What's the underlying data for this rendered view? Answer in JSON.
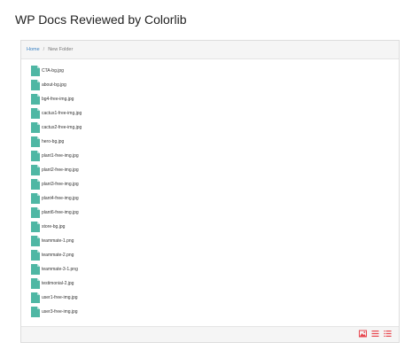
{
  "page": {
    "title": "WP Docs Reviewed by Colorlib"
  },
  "breadcrumb": {
    "home": "Home",
    "separator": "/",
    "current": "New Folder"
  },
  "files": [
    {
      "name": "CTA-bg.jpg"
    },
    {
      "name": "about-bg.jpg"
    },
    {
      "name": "bg4-free-img.jpg"
    },
    {
      "name": "cactus1-free-img.jpg"
    },
    {
      "name": "cactus2-free-img.jpg"
    },
    {
      "name": "hero-bg.jpg"
    },
    {
      "name": "plant1-free-img.jpg"
    },
    {
      "name": "plant2-free-img.jpg"
    },
    {
      "name": "plant3-free-img.jpg"
    },
    {
      "name": "plant4-free-img.jpg"
    },
    {
      "name": "plant6-free-img.jpg"
    },
    {
      "name": "store-bg.jpg"
    },
    {
      "name": "teammate-1.png"
    },
    {
      "name": "teammate-2.png"
    },
    {
      "name": "teammate-3-1.png"
    },
    {
      "name": "testimonial-2.jpg"
    },
    {
      "name": "user1-free-img.jpg"
    },
    {
      "name": "user3-free-img.jpg"
    }
  ],
  "colors": {
    "file_icon": "#4fb7a4",
    "view_buttons": "#e8474f",
    "link": "#3a82c4"
  },
  "view_modes": [
    {
      "icon": "image-view-icon"
    },
    {
      "icon": "list-view-icon"
    },
    {
      "icon": "detail-list-view-icon"
    }
  ]
}
